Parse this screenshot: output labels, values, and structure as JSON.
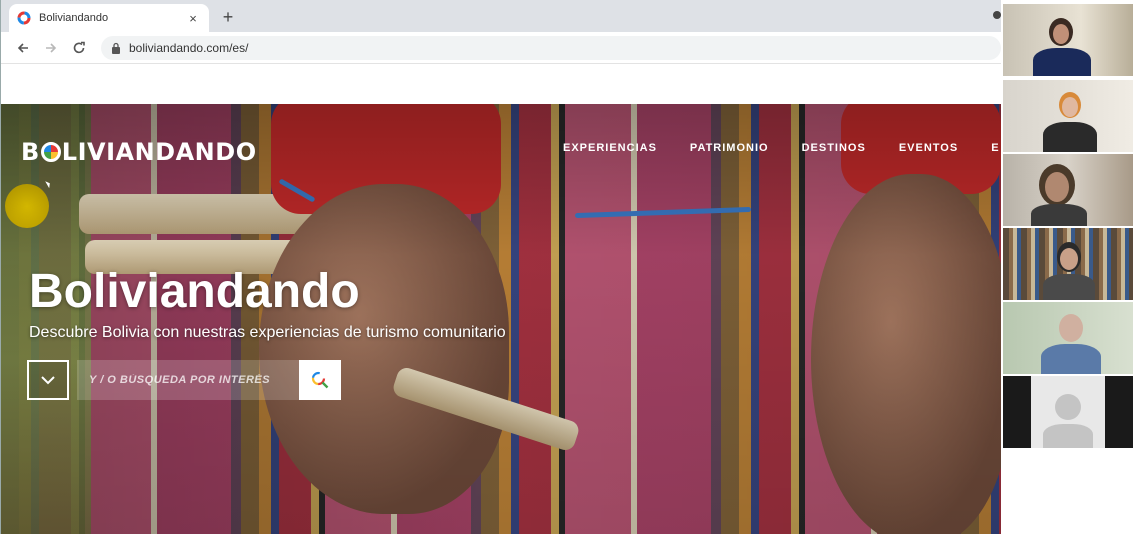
{
  "browser": {
    "tab_title": "Boliviandando",
    "new_tab_symbol": "+",
    "close_symbol": "×",
    "url": "boliviandando.com/es/"
  },
  "site": {
    "logo_prefix": "B",
    "logo_suffix": "LIVIANDANDO",
    "nav": [
      "EXPERIENCIAS",
      "PATRIMONIO",
      "DESTINOS",
      "EVENTOS",
      "E"
    ],
    "hero_title": "Boliviandando",
    "hero_subtitle": "Descubre Bolivia con nuestras experiencias de turismo comunitario",
    "search_placeholder": "Y / O BÚSQUEDA POR INTERÉS"
  },
  "icons": {
    "back": "arrow-left-icon",
    "forward": "arrow-right-icon",
    "reload": "reload-icon",
    "lock": "lock-icon",
    "dropdown": "chevron-down-icon",
    "search": "search-icon",
    "favicon": "favicon-icon"
  },
  "video_call": {
    "participants": [
      {
        "id": "p1"
      },
      {
        "id": "p2"
      },
      {
        "id": "p3"
      },
      {
        "id": "p4"
      },
      {
        "id": "p5"
      },
      {
        "id": "p6"
      }
    ]
  }
}
